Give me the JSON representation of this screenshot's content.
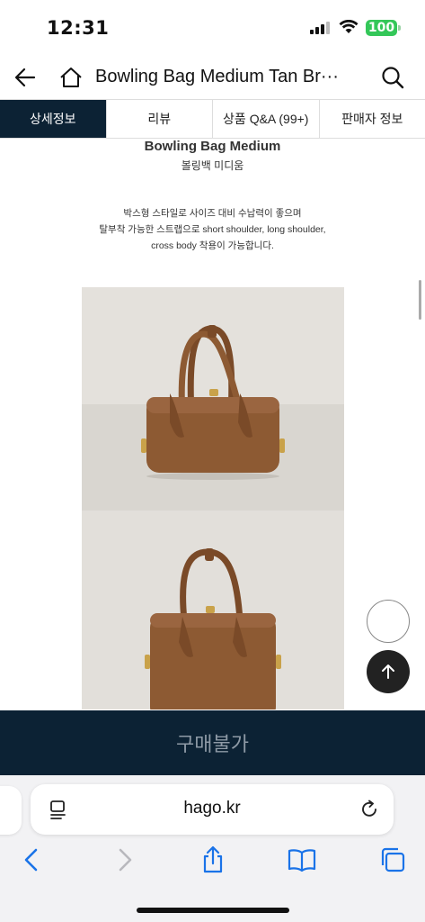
{
  "status_bar": {
    "time": "12:31",
    "battery": "100"
  },
  "header": {
    "title": "Bowling Bag Medium Tan Br···"
  },
  "tabs": [
    {
      "label": "상세정보",
      "active": true
    },
    {
      "label": "리뷰",
      "active": false
    },
    {
      "label": "상품 Q&A (99+)",
      "active": false
    },
    {
      "label": "판매자 정보",
      "active": false
    }
  ],
  "product": {
    "name": "Bowling Bag Medium",
    "name_kr": "볼링백 미디움",
    "description_lines": [
      "박스형 스타일로 사이즈 대비 수납력이 좋으며",
      "탈부착 가능한 스트랩으로 short shoulder, long shoulder,",
      "cross body 착용이 가능합니다."
    ]
  },
  "buy_bar": {
    "label": "구매불가"
  },
  "browser": {
    "url": "hago.kr"
  },
  "colors": {
    "navy": "#0c2234",
    "ios_blue": "#1a73e8",
    "battery_green": "#34c759",
    "bag_tan": "#8d5a33"
  }
}
